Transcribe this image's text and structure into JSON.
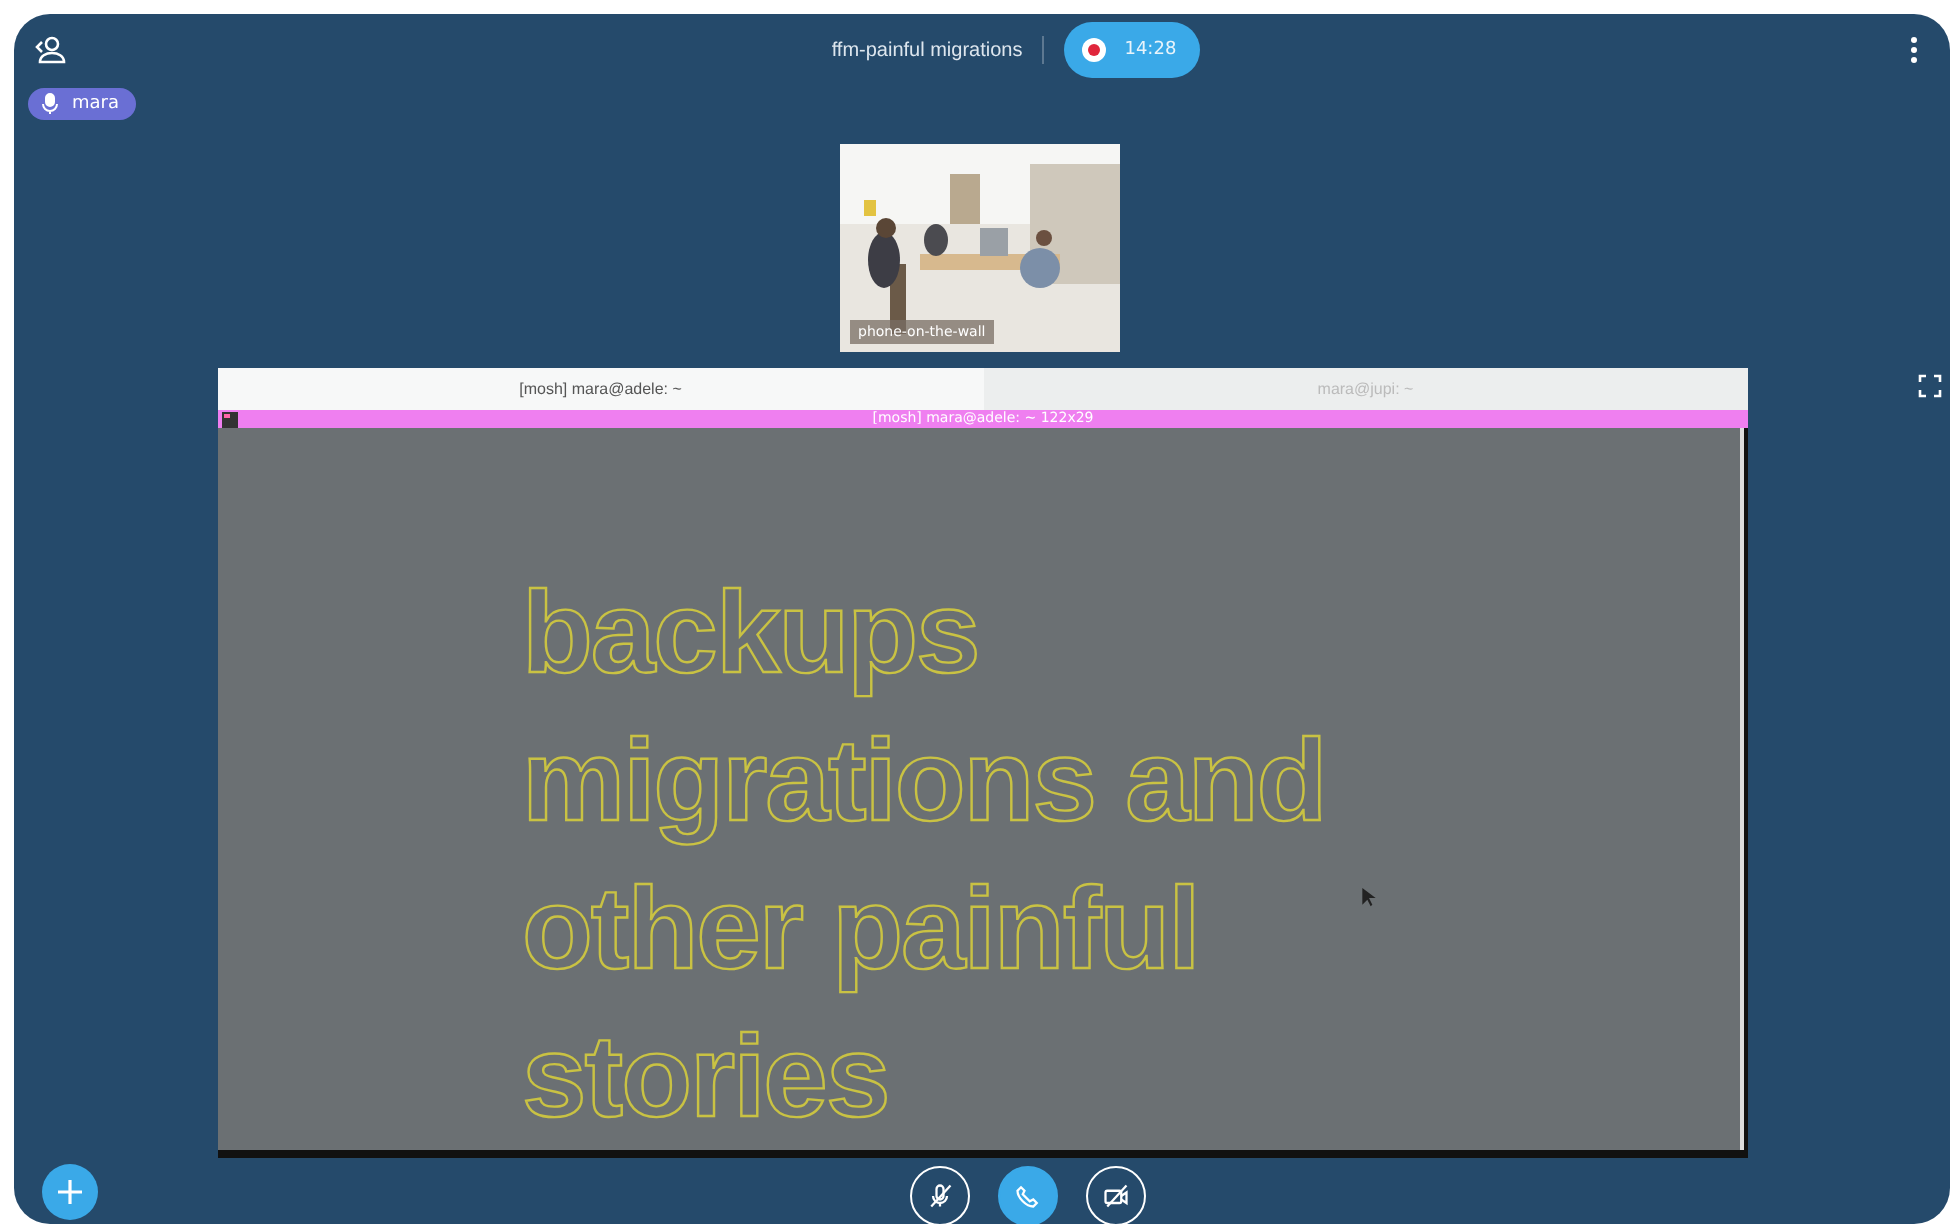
{
  "header": {
    "title": "ffm-painful migrations",
    "timer": "14:28",
    "recording": true
  },
  "participant": {
    "name": "mara",
    "speaking": true
  },
  "thumbnail": {
    "kind": "picture",
    "label": "phone-on-the-wall"
  },
  "terminal": {
    "tabs": [
      {
        "label": "[mosh] mara@adele: ~",
        "selected": true
      },
      {
        "label": "mara@jupi: ~",
        "selected": false
      }
    ],
    "title": "[mosh] mara@adele: ~  122x29",
    "lines": [
      "backups",
      "migrations and",
      "other painful",
      "stories"
    ]
  },
  "controls": [
    {
      "kind": "microphone",
      "on": false
    },
    {
      "kind": "phone",
      "on": true
    },
    {
      "kind": "camera",
      "on": false
    }
  ]
}
